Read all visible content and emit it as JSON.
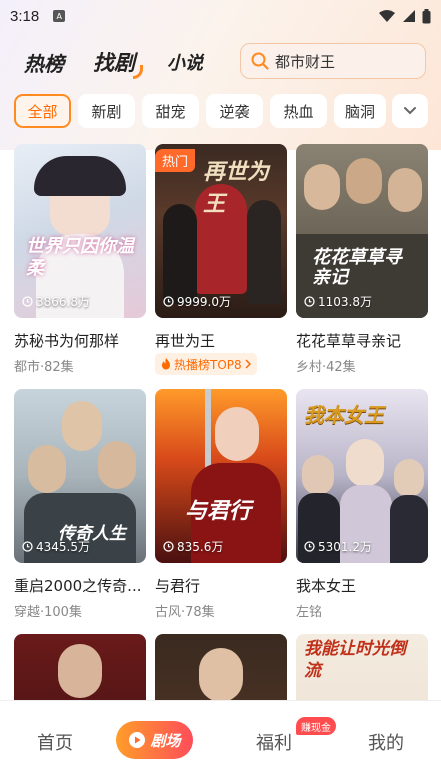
{
  "status_bar": {
    "time": "3:18",
    "notification_icon": "a-icon"
  },
  "header": {
    "tabs": [
      {
        "label": "热榜",
        "active": false
      },
      {
        "label": "找剧",
        "active": true
      },
      {
        "label": "小说",
        "active": false
      }
    ],
    "search": {
      "placeholder": "都市财王",
      "icon": "search-icon"
    }
  },
  "categories": {
    "items": [
      "全部",
      "新剧",
      "甜宠",
      "逆袭",
      "热血",
      "脑洞"
    ],
    "selected": "全部",
    "more_icon": "chevron-down-icon",
    "accent": "#ff8a1f"
  },
  "dramas": [
    {
      "title": "苏秘书为何那样",
      "views": "3866.8万",
      "meta": "都市·82集",
      "poster_text": "世界只因你温柔",
      "badge": ""
    },
    {
      "title": "再世为王",
      "views": "9999.0万",
      "meta": "",
      "poster_text": "再世为王",
      "badge": "热门",
      "rank": "热播榜TOP8"
    },
    {
      "title": "花花草草寻亲记",
      "views": "1103.8万",
      "meta": "乡村·42集",
      "poster_text": "花花草草寻亲记",
      "badge": ""
    },
    {
      "title": "重启2000之传奇...",
      "views": "4345.5万",
      "meta": "穿越·100集",
      "poster_text": "传奇人生",
      "badge": ""
    },
    {
      "title": "与君行",
      "views": "835.6万",
      "meta": "古风·78集",
      "poster_text": "与君行",
      "badge": ""
    },
    {
      "title": "我本女王",
      "views": "5301.2万",
      "meta": "左铭",
      "poster_text": "我本女王",
      "badge": ""
    },
    {
      "title": "",
      "views": "",
      "meta": "",
      "poster_text": "",
      "badge": ""
    },
    {
      "title": "",
      "views": "",
      "meta": "",
      "poster_text": "",
      "badge": ""
    },
    {
      "title": "",
      "views": "",
      "meta": "",
      "poster_text": "我能让时光倒流",
      "badge": ""
    }
  ],
  "bottom_nav": {
    "items": [
      {
        "label": "首页",
        "active": false
      },
      {
        "label": "剧场",
        "active": true
      },
      {
        "label": "福利",
        "active": false,
        "badge": "赚现金"
      },
      {
        "label": "我的",
        "active": false
      }
    ]
  },
  "colors": {
    "accent": "#ff8a1f",
    "hot": "#ff6a2a",
    "money": "#ff4d4f"
  }
}
